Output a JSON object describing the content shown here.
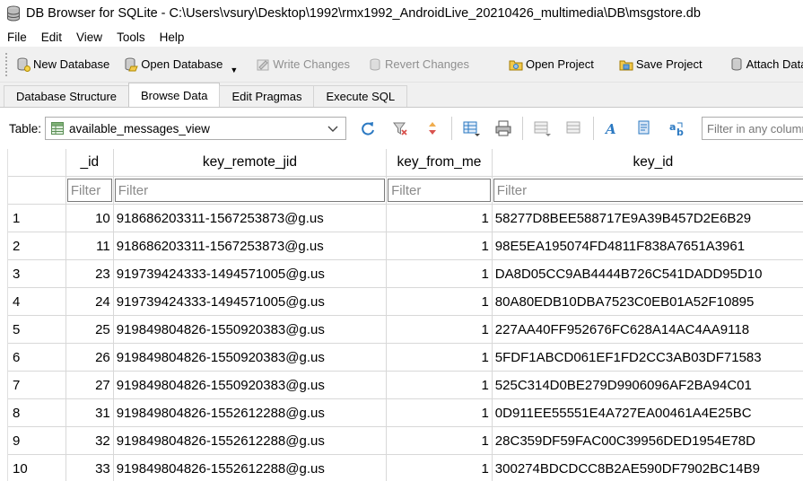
{
  "window": {
    "title": "DB Browser for SQLite - C:\\Users\\vsury\\Desktop\\1992\\rmx1992_AndroidLive_20210426_multimedia\\DB\\msgstore.db"
  },
  "menu": [
    "File",
    "Edit",
    "View",
    "Tools",
    "Help"
  ],
  "toolbar": {
    "new_database": "New Database",
    "open_database": "Open Database",
    "write_changes": "Write Changes",
    "revert_changes": "Revert Changes",
    "open_project": "Open Project",
    "save_project": "Save Project",
    "attach_database": "Attach Database"
  },
  "tabs": [
    "Database Structure",
    "Browse Data",
    "Edit Pragmas",
    "Execute SQL"
  ],
  "active_tab": "Browse Data",
  "browse": {
    "table_label": "Table:",
    "selected_table": "available_messages_view",
    "filter_any_placeholder": "Filter in any column"
  },
  "grid": {
    "columns": [
      "_id",
      "key_remote_jid",
      "key_from_me",
      "key_id"
    ],
    "filter_placeholder": "Filter",
    "rows": [
      [
        "1",
        "10",
        "918686203311-1567253873@g.us",
        "1",
        "58277D8BEE588717E9A39B457D2E6B29"
      ],
      [
        "2",
        "11",
        "918686203311-1567253873@g.us",
        "1",
        "98E5EA195074FD4811F838A7651A3961"
      ],
      [
        "3",
        "23",
        "919739424333-1494571005@g.us",
        "1",
        "DA8D05CC9AB4444B726C541DADD95D10"
      ],
      [
        "4",
        "24",
        "919739424333-1494571005@g.us",
        "1",
        "80A80EDB10DBA7523C0EB01A52F10895"
      ],
      [
        "5",
        "25",
        "919849804826-1550920383@g.us",
        "1",
        "227AA40FF952676FC628A14AC4AA9118"
      ],
      [
        "6",
        "26",
        "919849804826-1550920383@g.us",
        "1",
        "5FDF1ABCD061EF1FD2CC3AB03DF71583"
      ],
      [
        "7",
        "27",
        "919849804826-1550920383@g.us",
        "1",
        "525C314D0BE279D9906096AF2BA94C01"
      ],
      [
        "8",
        "31",
        "919849804826-1552612288@g.us",
        "1",
        "0D911EE55551E4A727EA00461A4E25BC"
      ],
      [
        "9",
        "32",
        "919849804826-1552612288@g.us",
        "1",
        "28C359DF59FAC00C39956DED1954E78D"
      ],
      [
        "10",
        "33",
        "919849804826-1552612288@g.us",
        "1",
        "300274BDCDCC8B2AE590DF7902BC14B9"
      ]
    ]
  },
  "colors": {
    "accent": "#2b79c2",
    "grid_border": "#d8d8d8",
    "background": "#f0f0f0"
  }
}
